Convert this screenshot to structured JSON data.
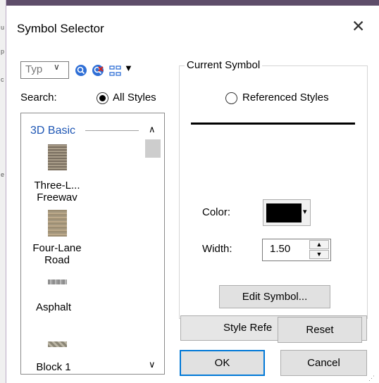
{
  "backdrop": {
    "glyphs": [
      "u",
      "p",
      "c",
      "e"
    ]
  },
  "dialog": {
    "title": "Symbol Selector",
    "close_glyph": "✕"
  },
  "toolbar": {
    "style_combo_text": "Typ",
    "style_combo_arrow": "∨",
    "view_menu_arrow": "▼",
    "icons": [
      "search-icon",
      "clear-search-icon",
      "view-options-icon"
    ]
  },
  "search": {
    "label": "Search:",
    "option_all": "All Styles",
    "option_referenced": "Referenced Styles",
    "selected": "All Styles"
  },
  "symbol_list": {
    "group": "3D Basic",
    "items": [
      {
        "label": "Three-L... Freeway",
        "line1": "Three-L...",
        "line2": "Freewav"
      },
      {
        "label": "Four-Lane Road",
        "line1": "Four-Lane",
        "line2": "Road"
      },
      {
        "label": "Asphalt",
        "line1": "Asphalt",
        "line2": ""
      },
      {
        "label": "Block 1",
        "line1": "Block 1",
        "line2": ""
      }
    ],
    "scroll_up": "∧",
    "scroll_down": "∨"
  },
  "current_symbol": {
    "group_label": "Current Symbol",
    "color_label": "Color:",
    "color_value": "#000000",
    "color_caret": "▾",
    "width_label": "Width:",
    "width_value": "1.50",
    "spin_up": "▲",
    "spin_down": "▼"
  },
  "buttons": {
    "edit_symbol": "Edit Symbol...",
    "style_references": "Style Refe",
    "reset": "Reset",
    "ok": "OK",
    "cancel": "Cancel"
  },
  "grip_glyph": "⋰"
}
